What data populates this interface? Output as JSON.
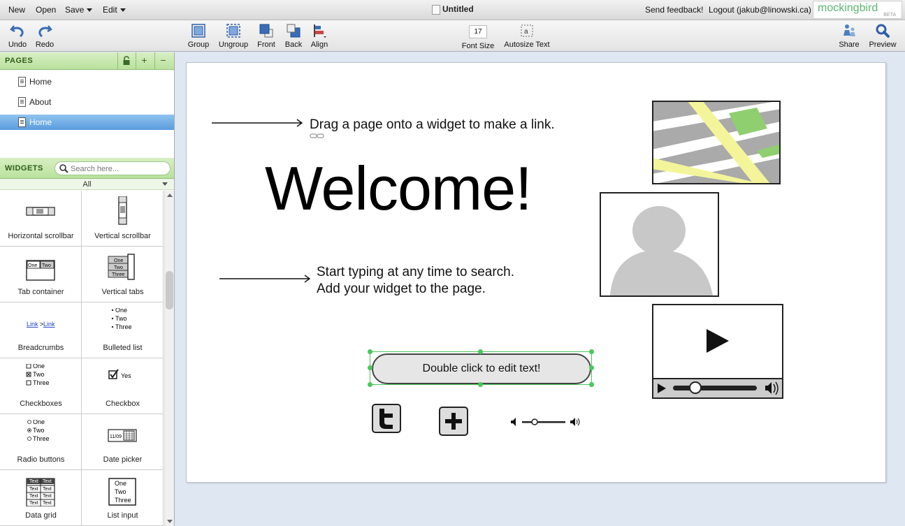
{
  "menubar": {
    "new_label": "New",
    "open_label": "Open",
    "save_label": "Save",
    "edit_label": "Edit",
    "document_title": "Untitled",
    "feedback_label": "Send feedback!",
    "logout_label": "Logout (jakub@linowski.ca)",
    "logo_text": "mockingbird",
    "logo_badge": "BETA"
  },
  "toolbar": {
    "undo": "Undo",
    "redo": "Redo",
    "group": "Group",
    "ungroup": "Ungroup",
    "front": "Front",
    "back": "Back",
    "align": "Align",
    "font_size_value": "17",
    "font_size_label": "Font Size",
    "autosize_label": "Autosize Text",
    "share": "Share",
    "preview": "Preview"
  },
  "pages_panel": {
    "title": "PAGES",
    "items": [
      {
        "label": "Home",
        "selected": false
      },
      {
        "label": "About",
        "selected": false
      },
      {
        "label": "Home",
        "selected": true
      }
    ]
  },
  "widgets_panel": {
    "title": "WIDGETS",
    "search_placeholder": "Search here...",
    "filter_value": "All",
    "items": [
      {
        "label": "Horizontal scrollbar",
        "icon": "horizontal-scrollbar-icon"
      },
      {
        "label": "Vertical scrollbar",
        "icon": "vertical-scrollbar-icon"
      },
      {
        "label": "Tab container",
        "icon": "tab-container-icon"
      },
      {
        "label": "Vertical tabs",
        "icon": "vertical-tabs-icon"
      },
      {
        "label": "Breadcrumbs",
        "icon": "breadcrumbs-icon"
      },
      {
        "label": "Bulleted list",
        "icon": "bulleted-list-icon"
      },
      {
        "label": "Checkboxes",
        "icon": "checkboxes-icon"
      },
      {
        "label": "Checkbox",
        "icon": "checkbox-icon"
      },
      {
        "label": "Radio buttons",
        "icon": "radio-buttons-icon"
      },
      {
        "label": "Date picker",
        "icon": "date-picker-icon"
      },
      {
        "label": "Data grid",
        "icon": "data-grid-icon"
      },
      {
        "label": "List input",
        "icon": "list-input-icon"
      }
    ],
    "icon_text": {
      "one": "One",
      "two": "Two",
      "three": "Three",
      "link": "Link",
      "yes": "Yes",
      "date": "11/09",
      "text": "Text"
    }
  },
  "canvas": {
    "hint_link": "Drag a page onto a widget to make a link.",
    "hint_search_line1": "Start typing at any time to search.",
    "hint_search_line2": "Add your widget to the page.",
    "welcome": "Welcome!",
    "button_text": "Double click to edit text!"
  },
  "colors": {
    "selection": "#48c85a",
    "panel_header": "#b9e19d",
    "selected_page": "#5a9bdf",
    "canvas_bg": "#dfe7f2",
    "logo": "#5ab56e"
  }
}
